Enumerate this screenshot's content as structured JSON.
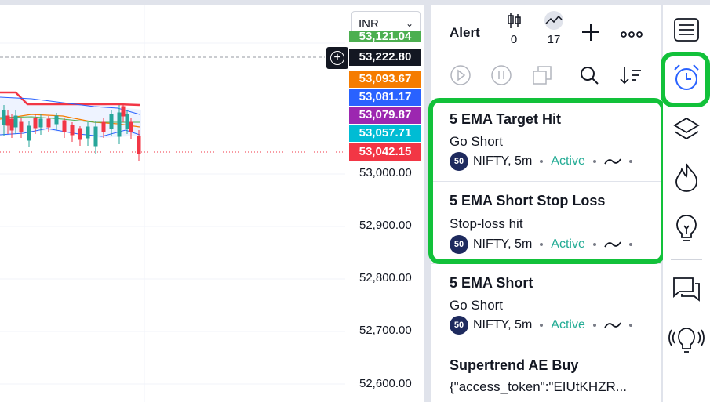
{
  "chart": {
    "currency": "INR",
    "price_labels": [
      {
        "text": "53,121.04",
        "color": "#4caf50"
      },
      {
        "text": "53,222.80",
        "color": "#131722"
      },
      {
        "text": "53,093.67",
        "color": "#f57c00"
      },
      {
        "text": "53,081.17",
        "color": "#2962ff"
      },
      {
        "text": "53,079.87",
        "color": "#9c27b0"
      },
      {
        "text": "53,057.71",
        "color": "#00bcd4"
      },
      {
        "text": "53,042.15",
        "color": "#f23645"
      }
    ],
    "axis_ticks": [
      "53,000.00",
      "52,900.00",
      "52,800.00",
      "52,700.00",
      "52,600.00"
    ]
  },
  "panel": {
    "title": "Alert",
    "candles_count": "0",
    "trend_count": "17"
  },
  "alerts": [
    {
      "title": "5 EMA Target Hit",
      "message": "Go Short",
      "badge": "50",
      "symbol": "NIFTY, 5m",
      "status": "Active"
    },
    {
      "title": "5 EMA Short Stop Loss",
      "message": "Stop-loss hit",
      "badge": "50",
      "symbol": "NIFTY, 5m",
      "status": "Active"
    },
    {
      "title": "5 EMA Short",
      "message": "Go Short",
      "badge": "50",
      "symbol": "NIFTY, 5m",
      "status": "Active"
    },
    {
      "title": "Supertrend AE Buy",
      "message": "{\"access_token\":\"EIUtKHZR..."
    }
  ],
  "colors": {
    "accent_green": "#12c13a",
    "active": "#22ab94",
    "up": "#26a69a",
    "down": "#f23645"
  }
}
